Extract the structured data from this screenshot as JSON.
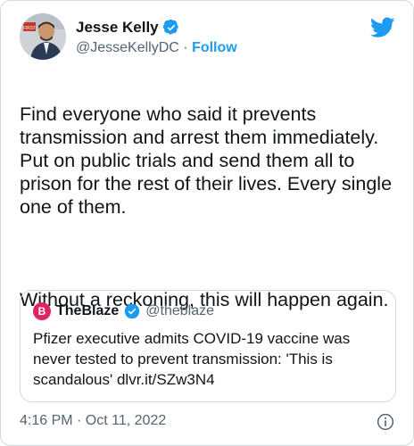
{
  "author": {
    "name": "Jesse Kelly",
    "handle": "@JesseKellyDC",
    "separator": "·",
    "follow_label": "Follow",
    "avatar_badge_text": "FIRST"
  },
  "tweet": {
    "text_paragraph_1": "Find everyone who said it prevents transmission and arrest them immediately. Put on public trials and send them all to prison for the rest of their lives. Every single one of them.",
    "text_paragraph_2": "Without a reckoning, this will happen again."
  },
  "quoted_tweet": {
    "name": "TheBlaze",
    "handle": "@theblaze",
    "logo_letter": "B",
    "text": "Pfizer executive admits COVID-19 vaccine was never tested to prevent transmission: 'This is scandalous' dlvr.it/SZw3N4"
  },
  "timestamp": "4:16 PM · Oct 11, 2022",
  "colors": {
    "brand_blue": "#1d9bf0",
    "blaze_red": "#e0245e",
    "text": "#0f1419",
    "muted": "#536471",
    "border": "#cfd9de"
  },
  "icons": {
    "logo": "twitter-bird-icon",
    "verified": "verified-badge-icon",
    "info": "info-icon"
  }
}
